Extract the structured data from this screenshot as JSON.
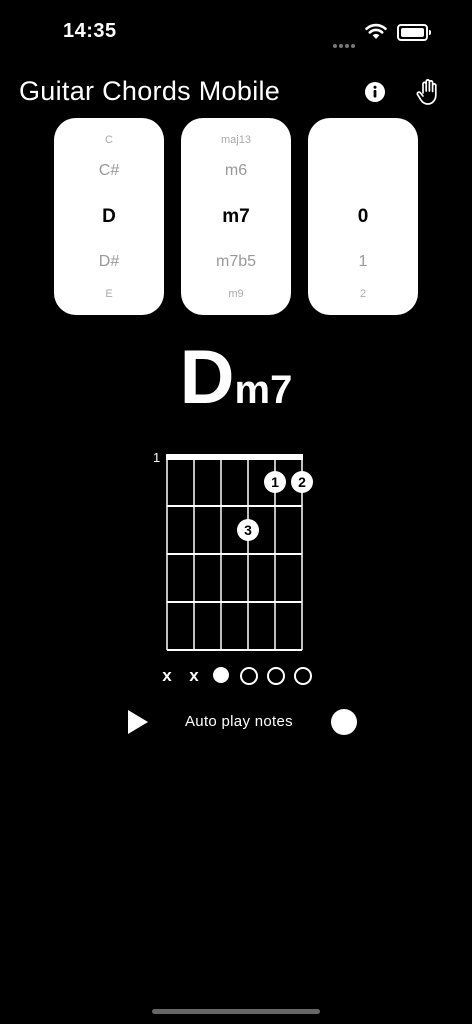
{
  "status": {
    "time": "14:35"
  },
  "header": {
    "title": "Guitar Chords Mobile",
    "info_icon": "info-icon",
    "hand_icon": "hand-icon"
  },
  "pickers": {
    "root": {
      "top": "C",
      "near1": "C#",
      "selected": "D",
      "near2": "D#",
      "bottom": "E"
    },
    "quality": {
      "top": "maj13",
      "near1": "m6",
      "selected": "m7",
      "near2": "m7b5",
      "bottom": "m9"
    },
    "voicing": {
      "top": "",
      "near1": "",
      "selected": "0",
      "near2": "1",
      "bottom": "2"
    }
  },
  "chord": {
    "root": "D",
    "quality": "m7"
  },
  "diagram": {
    "start_fret": "1",
    "strings": 6,
    "frets": 4,
    "fingers": [
      {
        "label": "1",
        "string": 5,
        "fret": 1
      },
      {
        "label": "2",
        "string": 6,
        "fret": 1
      },
      {
        "label": "3",
        "string": 4,
        "fret": 2
      }
    ],
    "string_status": [
      "x",
      "x",
      "played",
      "open",
      "open",
      "open"
    ]
  },
  "controls": {
    "play_icon": "play-icon",
    "auto_play_label": "Auto play notes"
  },
  "colors": {
    "background": "#000000",
    "foreground": "#ffffff",
    "muted": "#999999"
  }
}
